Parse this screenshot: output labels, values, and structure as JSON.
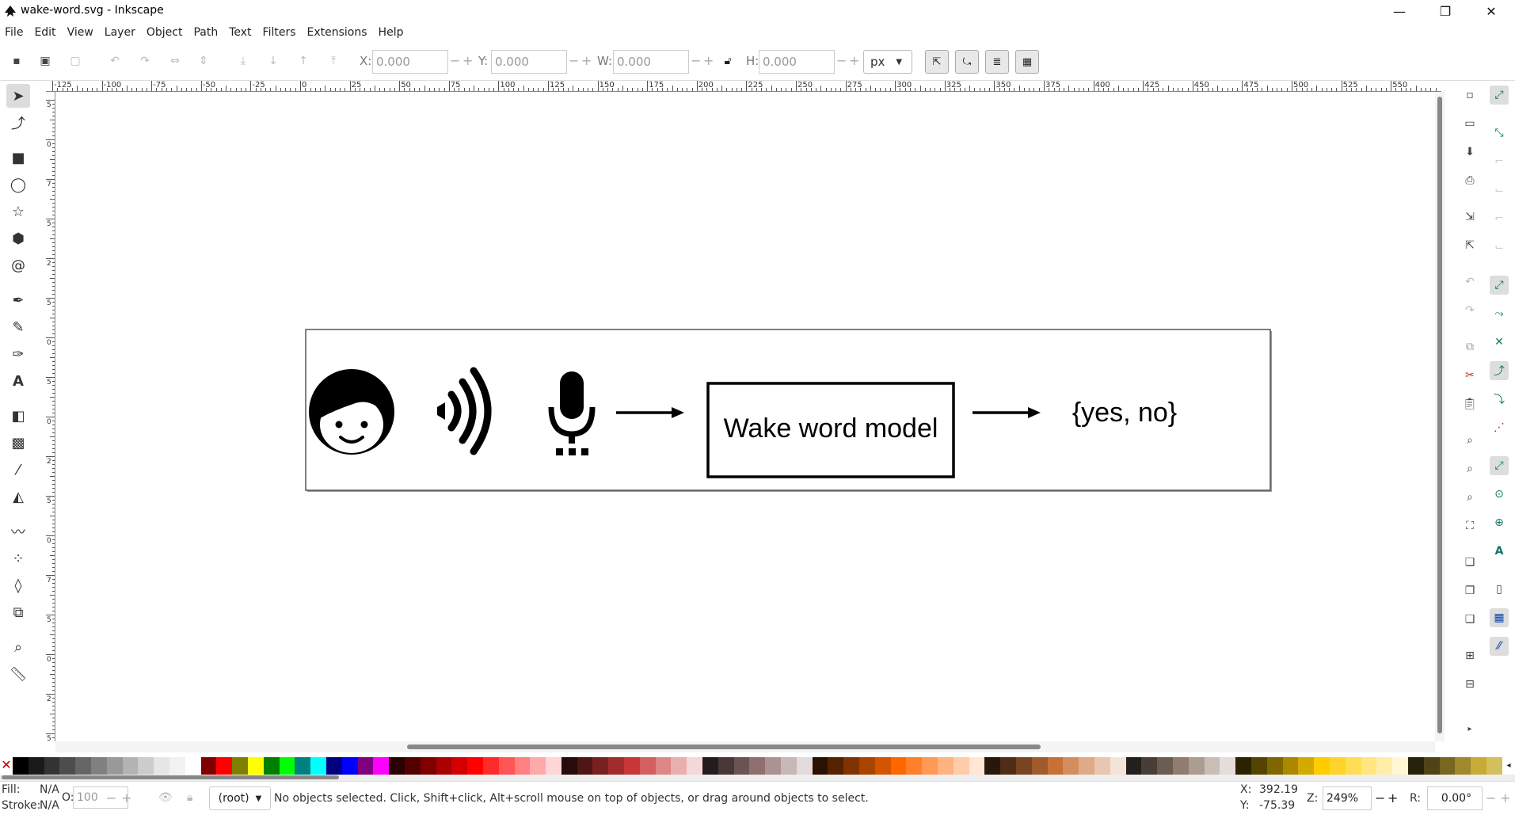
{
  "window": {
    "title": "wake-word.svg - Inkscape",
    "minimize_glyph": "—",
    "restore_glyph": "❐",
    "close_glyph": "✕"
  },
  "menu": [
    "File",
    "Edit",
    "View",
    "Layer",
    "Object",
    "Path",
    "Text",
    "Filters",
    "Extensions",
    "Help"
  ],
  "toolbar": {
    "x_label": "X:",
    "x_value": "0.000",
    "y_label": "Y:",
    "y_value": "0.000",
    "w_label": "W:",
    "w_value": "0.000",
    "h_label": "H:",
    "h_value": "0.000",
    "unit": "px",
    "minus": "−",
    "plus": "+"
  },
  "ruler": {
    "h_labels": [
      "-125",
      "-100",
      "-75",
      "-50",
      "-25",
      "0",
      "25",
      "50",
      "75",
      "100",
      "125",
      "150",
      "175",
      "200",
      "225",
      "250",
      "275",
      "300",
      "325",
      "350",
      "375",
      "400",
      "425",
      "450",
      "475",
      "500",
      "525",
      "550"
    ],
    "v_labels": [
      "5",
      "0",
      "7",
      "5",
      "2",
      "5",
      "0",
      "5",
      "0",
      "2",
      "5",
      "0",
      "7",
      "5",
      "0",
      "2",
      "5"
    ]
  },
  "drawing": {
    "model_label": "Wake word model",
    "output_label": "{yes, no}"
  },
  "tools": [
    "selector-icon",
    "node-icon",
    "rect-icon",
    "ellipse-icon",
    "star-icon",
    "box3d-icon",
    "spiral-icon",
    "pen-icon",
    "pencil-icon",
    "calligraphy-icon",
    "text-icon",
    "gradient-icon",
    "mesh-icon",
    "dropper-icon",
    "paintbucket-icon",
    "tweak-icon",
    "spray-icon",
    "eraser-icon",
    "connector-icon",
    "zoom-icon",
    "measure-icon"
  ],
  "palette_colors": [
    "#000000",
    "#1a1a1a",
    "#333333",
    "#4d4d4d",
    "#666666",
    "#808080",
    "#999999",
    "#b3b3b3",
    "#cccccc",
    "#e6e6e6",
    "#f2f2f2",
    "#ffffff",
    "#800000",
    "#ff0000",
    "#808000",
    "#ffff00",
    "#008000",
    "#00ff00",
    "#008080",
    "#00ffff",
    "#000080",
    "#0000ff",
    "#800080",
    "#ff00ff",
    "#2b0000",
    "#550000",
    "#800000",
    "#aa0000",
    "#d40000",
    "#ff0000",
    "#ff2a2a",
    "#ff5555",
    "#ff8080",
    "#ffaaaa",
    "#ffd5d5",
    "#280b0b",
    "#501616",
    "#782121",
    "#a02c2c",
    "#c83737",
    "#d35f5f",
    "#de8787",
    "#e9afaf",
    "#f4d7d7",
    "#241c1c",
    "#483737",
    "#6c5353",
    "#916f6f",
    "#ac9393",
    "#c8b7b7",
    "#e3dbdb",
    "#2b1100",
    "#552200",
    "#803300",
    "#aa4400",
    "#d45500",
    "#ff6600",
    "#ff7f2a",
    "#ff9955",
    "#ffb380",
    "#ffccaa",
    "#ffe6d5",
    "#28170b",
    "#502d16",
    "#784421",
    "#a05a2c",
    "#c87137",
    "#d38d5f",
    "#deaa87",
    "#e9c6af",
    "#f4e3d7",
    "#241f1c",
    "#483e37",
    "#6c5d53",
    "#917c6f",
    "#ac9d93",
    "#c8beb7",
    "#e3dedb",
    "#2b2200",
    "#554400",
    "#806600",
    "#aa8800",
    "#d4aa00",
    "#ffcc00",
    "#ffd42a",
    "#ffdd55",
    "#ffe680",
    "#ffeeaa",
    "#fff6d5",
    "#28220b",
    "#504416",
    "#786721",
    "#a0892c",
    "#c8ab37",
    "#d4bf5f"
  ],
  "status": {
    "fill_label": "Fill:",
    "fill_value": "N/A",
    "stroke_label": "Stroke:",
    "stroke_value": "N/A",
    "opacity_label": "O:",
    "opacity_value": "100",
    "layer": "(root)",
    "message": "No objects selected. Click, Shift+click, Alt+scroll mouse on top of objects, or drag around objects to select.",
    "x_label": "X:",
    "x_value": "392.19",
    "y_label": "Y:",
    "y_value": "-75.39",
    "zoom_label": "Z:",
    "zoom_value": "249%",
    "rot_label": "R:",
    "rot_value": "0.00°"
  }
}
